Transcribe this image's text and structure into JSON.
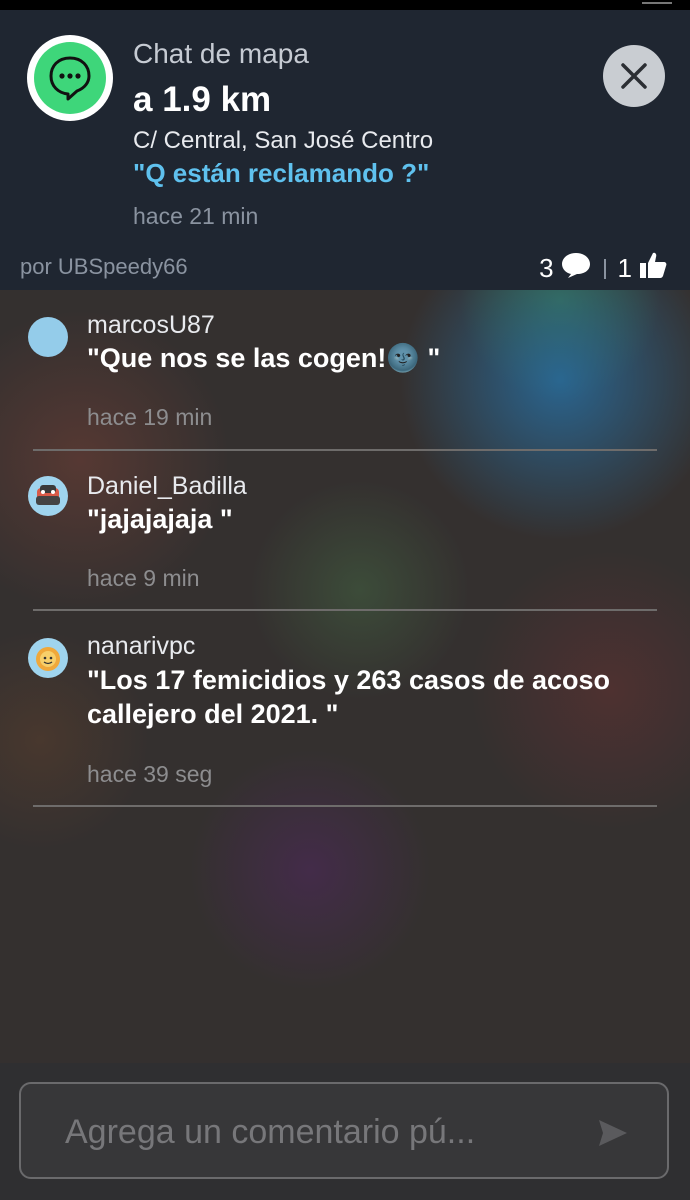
{
  "header": {
    "title": "Chat de mapa",
    "distance": "a 1.9 km",
    "address": "C/ Central, San José Centro",
    "topic": "\"Q están reclamando ?\"",
    "time": "hace 21 min",
    "author": "por UBSpeedy66",
    "comment_count": "3",
    "like_count": "1",
    "icons": [
      "map-chat-icon",
      "close-icon",
      "comment-bubble-icon",
      "thumbs-up-icon"
    ],
    "accent_color": "#5fc1ee",
    "brand_color": "#3ed67a"
  },
  "comments": [
    {
      "user": "marcosU87",
      "text": "\"Que nos se las cogen!🌚 \"",
      "time": "hace 19 min",
      "avatar": "blue-circle-avatar"
    },
    {
      "user": "Daniel_Badilla",
      "text": "\"jajajajaja \"",
      "time": "hace 9 min",
      "avatar": "wazer-car-avatar"
    },
    {
      "user": "nanarivpc",
      "text": "\"Los 17 femicidios y 263 casos de acoso callejero del 2021. \"",
      "time": "hace 39 seg",
      "avatar": "sun-avatar"
    }
  ],
  "input": {
    "placeholder": "Agrega un comentario pú...",
    "send_icon": "send-icon"
  }
}
